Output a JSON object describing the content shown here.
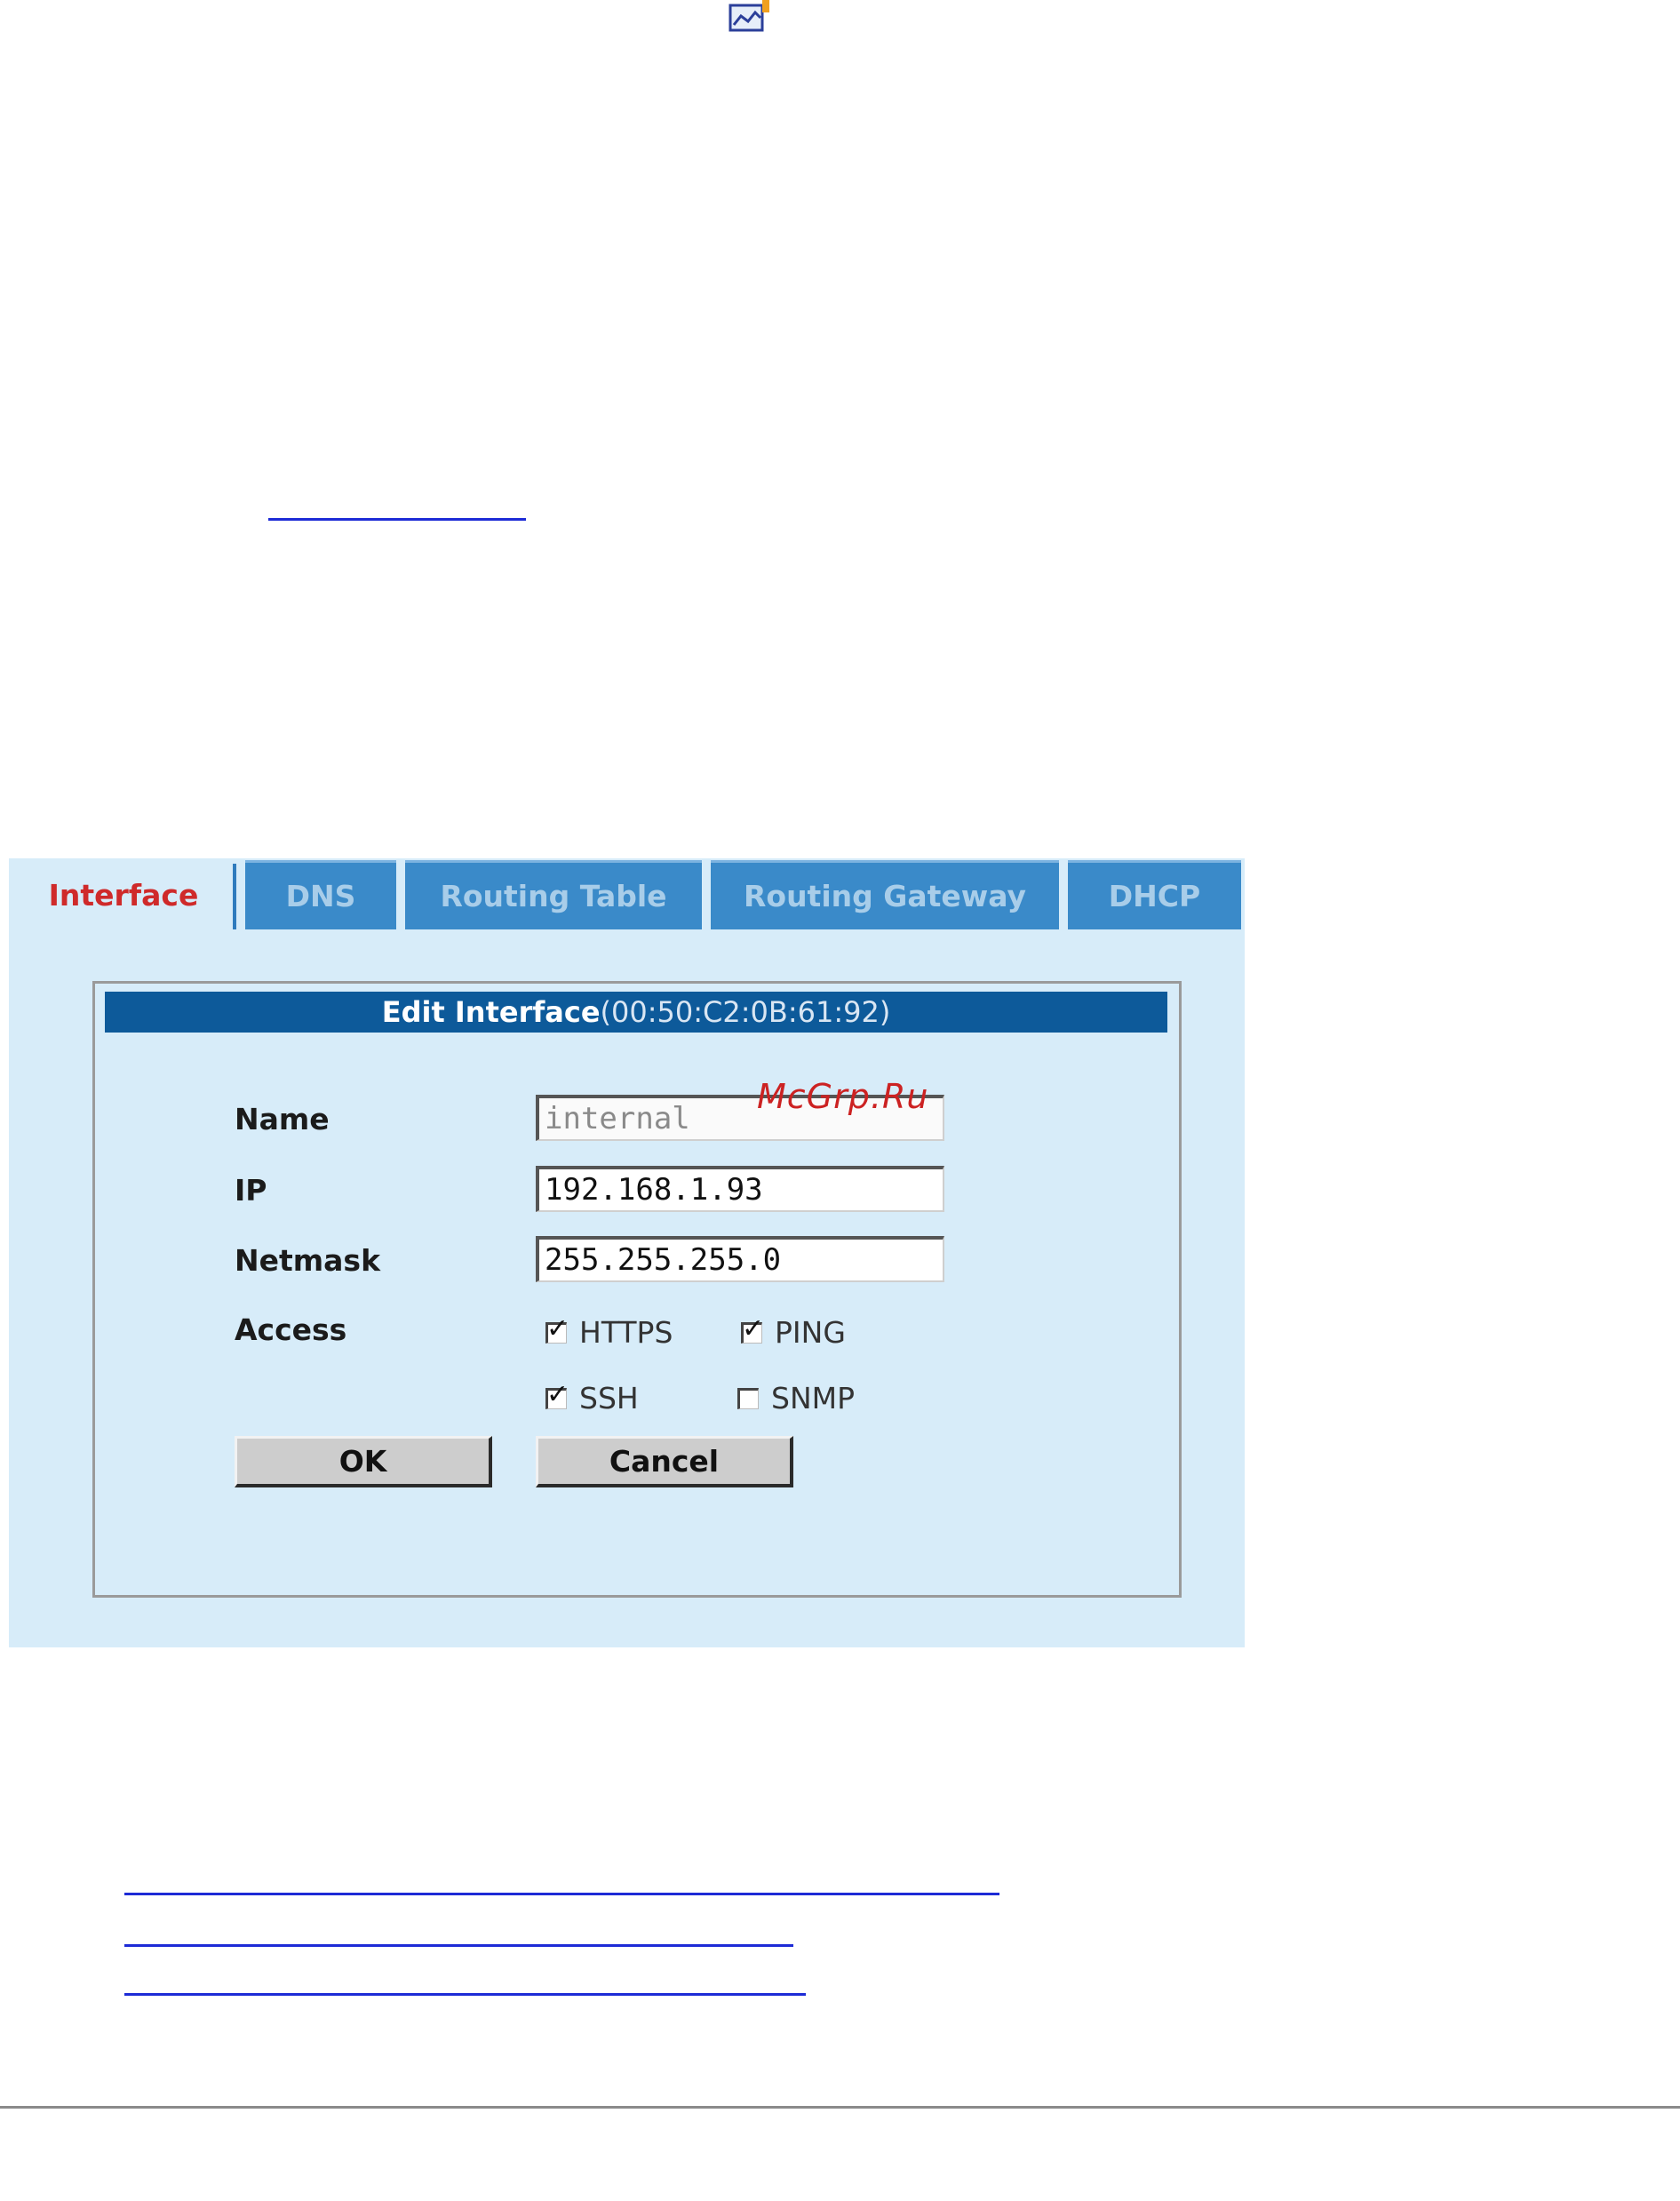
{
  "tabs": [
    {
      "label": "Interface",
      "active": true
    },
    {
      "label": "DNS",
      "active": false
    },
    {
      "label": "Routing Table",
      "active": false
    },
    {
      "label": "Routing Gateway",
      "active": false
    },
    {
      "label": "DHCP",
      "active": false
    }
  ],
  "form": {
    "title_bold": "Edit Interface",
    "title_mac": "(00:50:C2:0B:61:92)",
    "name_label": "Name",
    "name_value": "internal",
    "ip_label": "IP",
    "ip_value": "192.168.1.93",
    "netmask_label": "Netmask",
    "netmask_value": "255.255.255.0",
    "access_label": "Access",
    "access": {
      "https": {
        "label": "HTTPS",
        "checked": true
      },
      "ping": {
        "label": "PING",
        "checked": true
      },
      "ssh": {
        "label": "SSH",
        "checked": true
      },
      "snmp": {
        "label": "SNMP",
        "checked": false
      }
    },
    "ok_label": "OK",
    "cancel_label": "Cancel"
  },
  "watermark": "McGrp.Ru",
  "colors": {
    "panel_bg": "#d7ecf9",
    "tab_bg": "#3a8ac9",
    "active_tab_text": "#cf2a2a",
    "title_bar_bg": "#0d5a9a",
    "link_color": "#1d2bd6"
  }
}
